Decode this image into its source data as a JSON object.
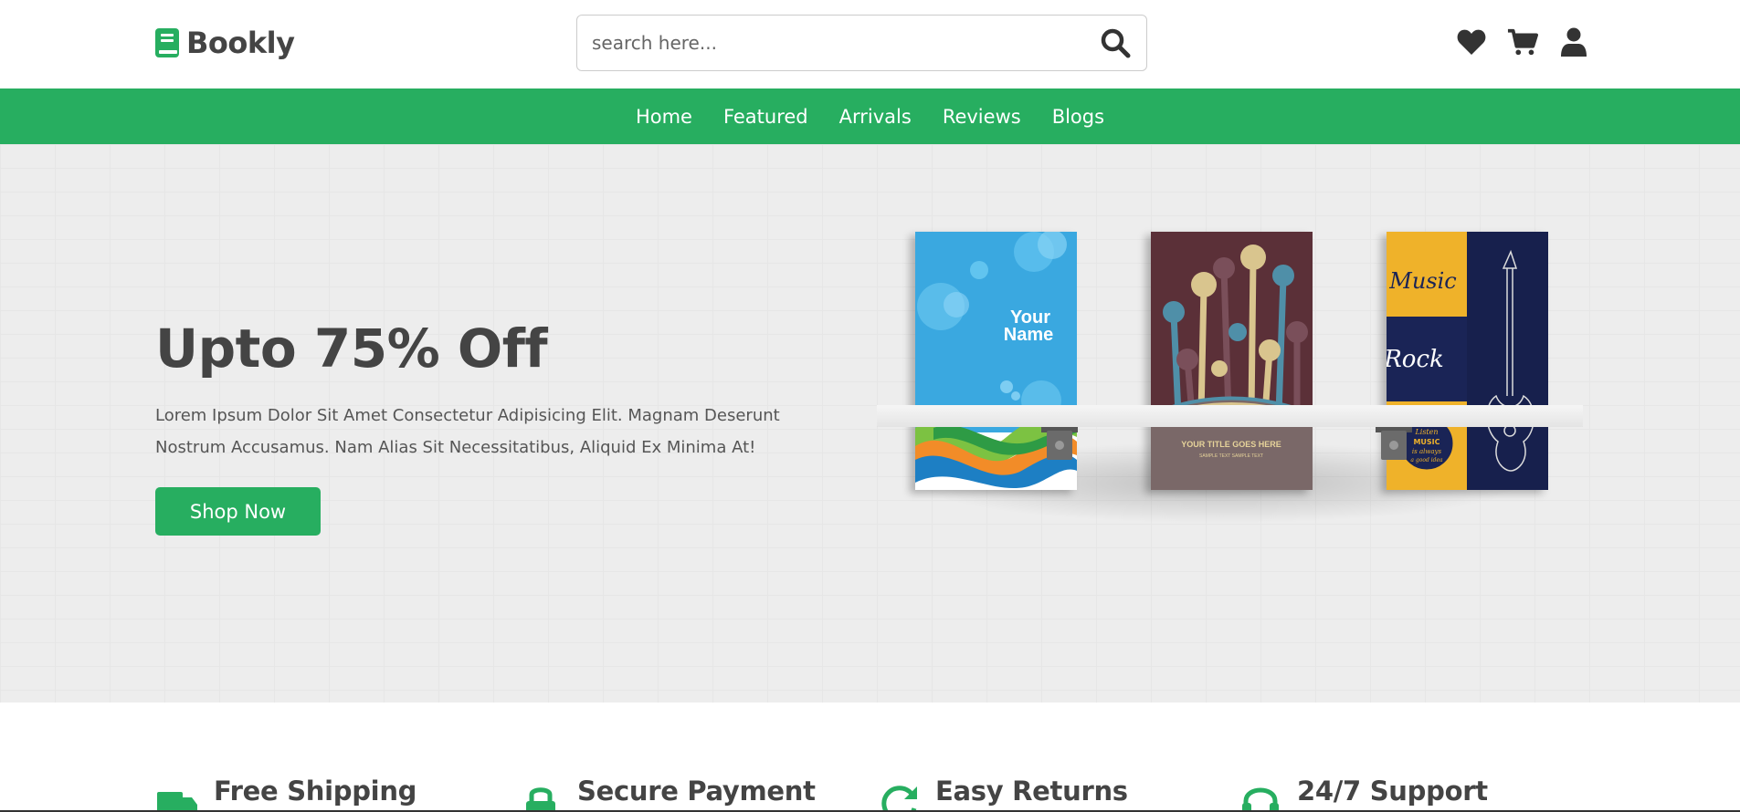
{
  "brand": {
    "name": "Bookly",
    "accent": "#27ae60"
  },
  "search": {
    "placeholder": "search here..."
  },
  "header_icons": [
    "heart-icon",
    "cart-icon",
    "user-icon"
  ],
  "nav": {
    "items": [
      "Home",
      "Featured",
      "Arrivals",
      "Reviews",
      "Blogs"
    ]
  },
  "hero": {
    "title": "Upto 75% Off",
    "description": "Lorem Ipsum Dolor Sit Amet Consectetur Adipisicing Elit. Magnam Deserunt Nostrum Accusamus. Nam Alias Sit Necessitatibus, Aliquid Ex Minima At!",
    "button": "Shop Now",
    "books": [
      {
        "title": "Your Name"
      },
      {
        "title": "YOUR TITLE GOES HERE",
        "subtitle": "SAMPLE TEXT SAMPLE TEXT"
      },
      {
        "title": "Music",
        "subtitle": "Rock",
        "badge": "Listen MUSIC is always a good idea"
      }
    ]
  },
  "features": [
    {
      "title": "Free Shipping",
      "icon": "truck-icon"
    },
    {
      "title": "Secure Payment",
      "icon": "lock-icon"
    },
    {
      "title": "Easy Returns",
      "icon": "redo-icon"
    },
    {
      "title": "24/7 Support",
      "icon": "headset-icon"
    }
  ]
}
